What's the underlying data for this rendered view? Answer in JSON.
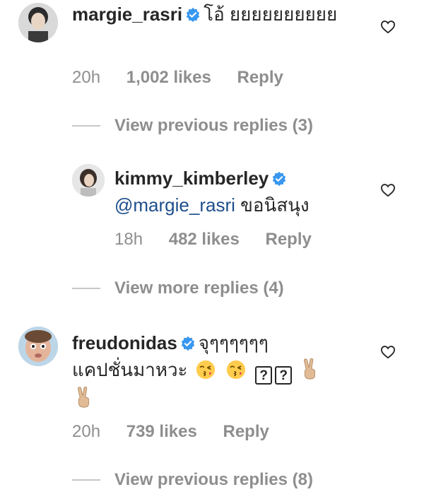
{
  "comments": [
    {
      "username": "margie_rasri",
      "text": "โอ้ ยยยยยยยยยย",
      "time": "20h",
      "likes": "1,002 likes",
      "reply": "Reply",
      "thread_link": "View previous replies (3)"
    },
    {
      "username": "kimmy_kimberley",
      "mention": "@margie_rasri",
      "text": "ขอนิสนุง",
      "time": "18h",
      "likes": "482 likes",
      "reply": "Reply",
      "thread_link": "View more replies (4)"
    },
    {
      "username": "freudonidas",
      "text_line1": "จุๆๆๆๆๆๆ",
      "text_line2": "แคปชั่นมาหวะ",
      "emoji_box": "?",
      "time": "20h",
      "likes": "739 likes",
      "reply": "Reply",
      "thread_link": "View previous replies (8)"
    }
  ],
  "icons": {
    "verified": "verified-badge-icon",
    "like": "heart-outline-icon",
    "kiss_face": "face-blowing-kiss-emoji",
    "victory_hand": "victory-hand-emoji"
  },
  "colors": {
    "verified_blue": "#3897f0",
    "mention": "#1e4e8c",
    "muted": "#8e8e8e",
    "text": "#262626"
  }
}
